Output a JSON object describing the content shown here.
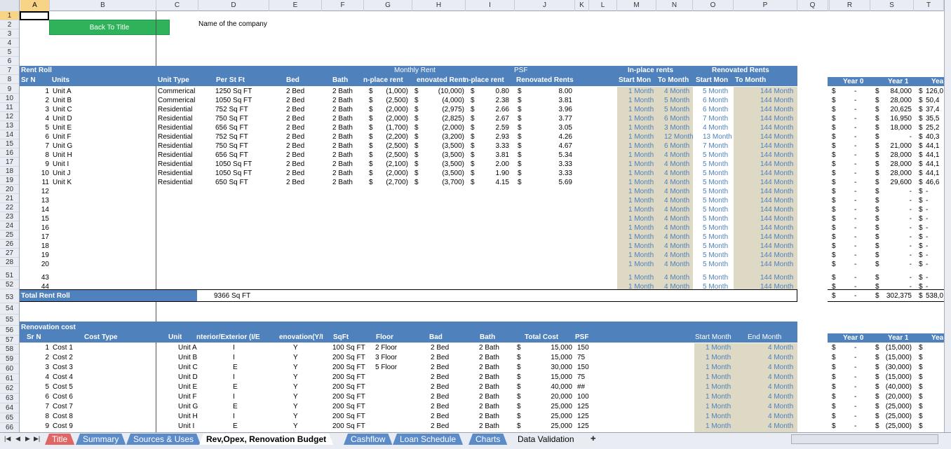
{
  "columns": [
    [
      "A",
      29,
      42
    ],
    [
      "B",
      71,
      152
    ],
    [
      "C",
      223,
      60
    ],
    [
      "D",
      283,
      101
    ],
    [
      "E",
      384,
      75
    ],
    [
      "F",
      459,
      60
    ],
    [
      "G",
      519,
      69
    ],
    [
      "H",
      588,
      76
    ],
    [
      "I",
      664,
      70
    ],
    [
      "J",
      734,
      86
    ],
    [
      "K",
      820,
      20
    ],
    [
      "L",
      840,
      40
    ],
    [
      "M",
      880,
      56
    ],
    [
      "N",
      936,
      52
    ],
    [
      "O",
      988,
      58
    ],
    [
      "P",
      1046,
      91
    ],
    [
      "Q",
      1137,
      44
    ],
    [
      "",
      1181,
      2
    ],
    [
      "R",
      1183,
      58
    ],
    [
      "S",
      1241,
      62
    ],
    [
      "T",
      1303,
      43
    ]
  ],
  "row_numbers": [
    "1",
    "2",
    "3",
    "4",
    "5",
    "6",
    "7",
    "8",
    "9",
    "10",
    "11",
    "12",
    "13",
    "14",
    "15",
    "16",
    "17",
    "18",
    "19",
    "20",
    "21",
    "22",
    "23",
    "24",
    "25",
    "26",
    "27",
    "28",
    "51",
    "52",
    "53",
    "54",
    "55",
    "56",
    "57",
    "58",
    "59",
    "60",
    "61",
    "62",
    "63",
    "64",
    "65",
    "66"
  ],
  "back_button": "Back To Title",
  "company_name": "Name of the company",
  "rent_roll": {
    "title": "Rent Roll",
    "header_monthly": "Monthly Rent",
    "header_psf": "PSF",
    "header_inplace": "In-place rents",
    "header_renovated": "Renovated Rents",
    "columns": [
      "Sr N",
      "Units",
      "Unit Type",
      "Per St Ft",
      "Bed",
      "Bath",
      "n-place rent",
      "enovated Rent",
      "n-place rent",
      "Renovated Rents",
      "Start Mon",
      "To Month",
      "Start Mon",
      "To Month"
    ],
    "rows": [
      [
        "1",
        "Unit A",
        "Commerical",
        "1250 Sq FT",
        "2 Bed",
        "2 Bath",
        "$",
        "(1,000)",
        "$",
        "(10,000)",
        "$",
        "0.80",
        "$",
        "8.00",
        "1 Month",
        "4 Month",
        "5 Month",
        "144 Month"
      ],
      [
        "2",
        "Unit B",
        "Commerical",
        "1050 Sq FT",
        "2 Bed",
        "2 Bath",
        "$",
        "(2,500)",
        "$",
        "(4,000)",
        "$",
        "2.38",
        "$",
        "3.81",
        "1 Month",
        "5 Month",
        "6 Month",
        "144 Month"
      ],
      [
        "3",
        "Unit C",
        "Residential",
        "752 Sq FT",
        "2 Bed",
        "2 Bath",
        "$",
        "(2,000)",
        "$",
        "(2,975)",
        "$",
        "2.66",
        "$",
        "3.96",
        "1 Month",
        "5 Month",
        "6 Month",
        "144 Month"
      ],
      [
        "4",
        "Unit D",
        "Residential",
        "750 Sq FT",
        "2 Bed",
        "2 Bath",
        "$",
        "(2,000)",
        "$",
        "(2,825)",
        "$",
        "2.67",
        "$",
        "3.77",
        "1 Month",
        "6 Month",
        "7 Month",
        "144 Month"
      ],
      [
        "5",
        "Unit E",
        "Residential",
        "656 Sq FT",
        "2 Bed",
        "2 Bath",
        "$",
        "(1,700)",
        "$",
        "(2,000)",
        "$",
        "2.59",
        "$",
        "3.05",
        "1 Month",
        "3 Month",
        "4 Month",
        "144 Month"
      ],
      [
        "6",
        "Unit F",
        "Residential",
        "752 Sq FT",
        "2 Bed",
        "2 Bath",
        "$",
        "(2,200)",
        "$",
        "(3,200)",
        "$",
        "2.93",
        "$",
        "4.26",
        "1 Month",
        "12 Month",
        "13 Month",
        "144 Month"
      ],
      [
        "7",
        "Unit G",
        "Residential",
        "750 Sq FT",
        "2 Bed",
        "2 Bath",
        "$",
        "(2,500)",
        "$",
        "(3,500)",
        "$",
        "3.33",
        "$",
        "4.67",
        "1 Month",
        "6 Month",
        "7 Month",
        "144 Month"
      ],
      [
        "8",
        "Unit H",
        "Residential",
        "656 Sq FT",
        "2 Bed",
        "2 Bath",
        "$",
        "(2,500)",
        "$",
        "(3,500)",
        "$",
        "3.81",
        "$",
        "5.34",
        "1 Month",
        "4 Month",
        "5 Month",
        "144 Month"
      ],
      [
        "9",
        "Unit I",
        "Residential",
        "1050 Sq FT",
        "2 Bed",
        "2 Bath",
        "$",
        "(2,100)",
        "$",
        "(3,500)",
        "$",
        "2.00",
        "$",
        "3.33",
        "1 Month",
        "4 Month",
        "5 Month",
        "144 Month"
      ],
      [
        "10",
        "Unit J",
        "Residential",
        "1050 Sq FT",
        "2 Bed",
        "2 Bath",
        "$",
        "(2,000)",
        "$",
        "(3,500)",
        "$",
        "1.90",
        "$",
        "3.33",
        "1 Month",
        "4 Month",
        "5 Month",
        "144 Month"
      ],
      [
        "11",
        "Unit K",
        "Residential",
        "650 Sq FT",
        "2 Bed",
        "2 Bath",
        "$",
        "(2,700)",
        "$",
        "(3,700)",
        "$",
        "4.15",
        "$",
        "5.69",
        "1 Month",
        "4 Month",
        "5 Month",
        "144 Month"
      ],
      [
        "12",
        "",
        "",
        "",
        "",
        "",
        "",
        "",
        "",
        "",
        "",
        "",
        "",
        "",
        "1 Month",
        "4 Month",
        "5 Month",
        "144 Month"
      ],
      [
        "13",
        "",
        "",
        "",
        "",
        "",
        "",
        "",
        "",
        "",
        "",
        "",
        "",
        "",
        "1 Month",
        "4 Month",
        "5 Month",
        "144 Month"
      ],
      [
        "14",
        "",
        "",
        "",
        "",
        "",
        "",
        "",
        "",
        "",
        "",
        "",
        "",
        "",
        "1 Month",
        "4 Month",
        "5 Month",
        "144 Month"
      ],
      [
        "15",
        "",
        "",
        "",
        "",
        "",
        "",
        "",
        "",
        "",
        "",
        "",
        "",
        "",
        "1 Month",
        "4 Month",
        "5 Month",
        "144 Month"
      ],
      [
        "16",
        "",
        "",
        "",
        "",
        "",
        "",
        "",
        "",
        "",
        "",
        "",
        "",
        "",
        "1 Month",
        "4 Month",
        "5 Month",
        "144 Month"
      ],
      [
        "17",
        "",
        "",
        "",
        "",
        "",
        "",
        "",
        "",
        "",
        "",
        "",
        "",
        "",
        "1 Month",
        "4 Month",
        "5 Month",
        "144 Month"
      ],
      [
        "18",
        "",
        "",
        "",
        "",
        "",
        "",
        "",
        "",
        "",
        "",
        "",
        "",
        "",
        "1 Month",
        "4 Month",
        "5 Month",
        "144 Month"
      ],
      [
        "19",
        "",
        "",
        "",
        "",
        "",
        "",
        "",
        "",
        "",
        "",
        "",
        "",
        "",
        "1 Month",
        "4 Month",
        "5 Month",
        "144 Month"
      ],
      [
        "20",
        "",
        "",
        "",
        "",
        "",
        "",
        "",
        "",
        "",
        "",
        "",
        "",
        "",
        "1 Month",
        "4 Month",
        "5 Month",
        "144 Month"
      ],
      [
        "43",
        "",
        "",
        "",
        "",
        "",
        "",
        "",
        "",
        "",
        "",
        "",
        "",
        "",
        "1 Month",
        "4 Month",
        "5 Month",
        "144 Month"
      ],
      [
        "44",
        "",
        "",
        "",
        "",
        "",
        "",
        "",
        "",
        "",
        "",
        "",
        "",
        "",
        "1 Month",
        "4 Month",
        "5 Month",
        "144 Month"
      ]
    ],
    "total_label": "Total Rent Roll",
    "total_sqft": "9366 Sq FT"
  },
  "year_table_1": {
    "headers": [
      "Year 0",
      "Year 1",
      "Yea"
    ],
    "rows": [
      [
        "$",
        "-",
        "$",
        "84,000",
        "$",
        "126,0"
      ],
      [
        "$",
        "-",
        "$",
        "28,000",
        "$",
        "50,4"
      ],
      [
        "$",
        "-",
        "$",
        "20,625",
        "$",
        "37,4"
      ],
      [
        "$",
        "-",
        "$",
        "16,950",
        "$",
        "35,5"
      ],
      [
        "$",
        "-",
        "$",
        "18,000",
        "$",
        "25,2"
      ],
      [
        "$",
        "-",
        "$",
        "-",
        "$",
        "40,3"
      ],
      [
        "$",
        "-",
        "$",
        "21,000",
        "$",
        "44,1"
      ],
      [
        "$",
        "-",
        "$",
        "28,000",
        "$",
        "44,1"
      ],
      [
        "$",
        "-",
        "$",
        "28,000",
        "$",
        "44,1"
      ],
      [
        "$",
        "-",
        "$",
        "28,000",
        "$",
        "44,1"
      ],
      [
        "$",
        "-",
        "$",
        "29,600",
        "$",
        "46,6"
      ],
      [
        "$",
        "-",
        "$",
        "-",
        "$",
        "-"
      ],
      [
        "$",
        "-",
        "$",
        "-",
        "$",
        "-"
      ],
      [
        "$",
        "-",
        "$",
        "-",
        "$",
        "-"
      ],
      [
        "$",
        "-",
        "$",
        "-",
        "$",
        "-"
      ],
      [
        "$",
        "-",
        "$",
        "-",
        "$",
        "-"
      ],
      [
        "$",
        "-",
        "$",
        "-",
        "$",
        "-"
      ],
      [
        "$",
        "-",
        "$",
        "-",
        "$",
        "-"
      ],
      [
        "$",
        "-",
        "$",
        "-",
        "$",
        "-"
      ],
      [
        "$",
        "-",
        "$",
        "-",
        "$",
        "-"
      ],
      [
        "$",
        "-",
        "$",
        "-",
        "$",
        "-"
      ],
      [
        "$",
        "-",
        "$",
        "-",
        "$",
        "-"
      ]
    ],
    "total": [
      "$",
      "-",
      "$",
      "302,375",
      "$",
      "538,0"
    ]
  },
  "renovation": {
    "title": "Renovation cost",
    "columns": [
      "Sr N",
      "Cost Type",
      "Unit",
      "nterior/Exterior (I/E",
      "enovation(Y/I",
      "SqFt",
      "Floor",
      "Bad",
      "Bath",
      "Total Cost",
      "PSF",
      "Start Month",
      "End Month"
    ],
    "rows": [
      [
        "1",
        "Cost 1",
        "Unit A",
        "I",
        "Y",
        "100 Sq FT",
        "2 Floor",
        "2 Bed",
        "2 Bath",
        "$",
        "15,000",
        "150",
        "1 Month",
        "4 Month"
      ],
      [
        "2",
        "Cost 2",
        "Unit B",
        "I",
        "Y",
        "200 Sq FT",
        "3 Floor",
        "2 Bed",
        "2 Bath",
        "$",
        "15,000",
        "75",
        "1 Month",
        "4 Month"
      ],
      [
        "3",
        "Cost 3",
        "Unit C",
        "E",
        "Y",
        "200 Sq FT",
        "5 Floor",
        "2 Bed",
        "2 Bath",
        "$",
        "30,000",
        "150",
        "1 Month",
        "4 Month"
      ],
      [
        "4",
        "Cost 4",
        "Unit D",
        "I",
        "Y",
        "200 Sq FT",
        "",
        "2 Bed",
        "2 Bath",
        "$",
        "15,000",
        "75",
        "1 Month",
        "4 Month"
      ],
      [
        "5",
        "Cost 5",
        "Unit E",
        "E",
        "Y",
        "200 Sq FT",
        "",
        "2 Bed",
        "2 Bath",
        "$",
        "40,000",
        "##",
        "1 Month",
        "4 Month"
      ],
      [
        "6",
        "Cost 6",
        "Unit F",
        "I",
        "Y",
        "200 Sq FT",
        "",
        "2 Bed",
        "2 Bath",
        "$",
        "20,000",
        "100",
        "1 Month",
        "4 Month"
      ],
      [
        "7",
        "Cost 7",
        "Unit G",
        "E",
        "Y",
        "200 Sq FT",
        "",
        "2 Bed",
        "2 Bath",
        "$",
        "25,000",
        "125",
        "1 Month",
        "4 Month"
      ],
      [
        "8",
        "Cost 8",
        "Unit H",
        "I",
        "Y",
        "200 Sq FT",
        "",
        "2 Bed",
        "2 Bath",
        "$",
        "25,000",
        "125",
        "1 Month",
        "4 Month"
      ],
      [
        "9",
        "Cost 9",
        "Unit I",
        "E",
        "Y",
        "200 Sq FT",
        "",
        "2 Bed",
        "2 Bath",
        "$",
        "25,000",
        "125",
        "1 Month",
        "4 Month"
      ]
    ]
  },
  "year_table_2": {
    "headers": [
      "Year 0",
      "Year 1",
      "Yea"
    ],
    "rows": [
      [
        "$",
        "-",
        "$",
        "(15,000)",
        "$",
        ""
      ],
      [
        "$",
        "-",
        "$",
        "(15,000)",
        "$",
        ""
      ],
      [
        "$",
        "-",
        "$",
        "(30,000)",
        "$",
        ""
      ],
      [
        "$",
        "-",
        "$",
        "(15,000)",
        "$",
        ""
      ],
      [
        "$",
        "-",
        "$",
        "(40,000)",
        "$",
        ""
      ],
      [
        "$",
        "-",
        "$",
        "(20,000)",
        "$",
        ""
      ],
      [
        "$",
        "-",
        "$",
        "(25,000)",
        "$",
        ""
      ],
      [
        "$",
        "-",
        "$",
        "(25,000)",
        "$",
        ""
      ],
      [
        "$",
        "-",
        "$",
        "(25,000)",
        "$",
        ""
      ]
    ]
  },
  "sheet_tabs": [
    "Title",
    "Summary",
    "Sources & Uses",
    "Rev,Opex, Renovation Budget",
    "Cashflow",
    "Loan Schedule",
    "Charts",
    "Data Validation"
  ],
  "active_tab": "Rev,Opex, Renovation Budget",
  "colors": {
    "band": "#4f81bd",
    "beige": "#ddd9c4",
    "button": "#2eb35a",
    "tab_red": "#e06666",
    "tab_blue": "#5b8bc8",
    "select": "#f8d586"
  }
}
